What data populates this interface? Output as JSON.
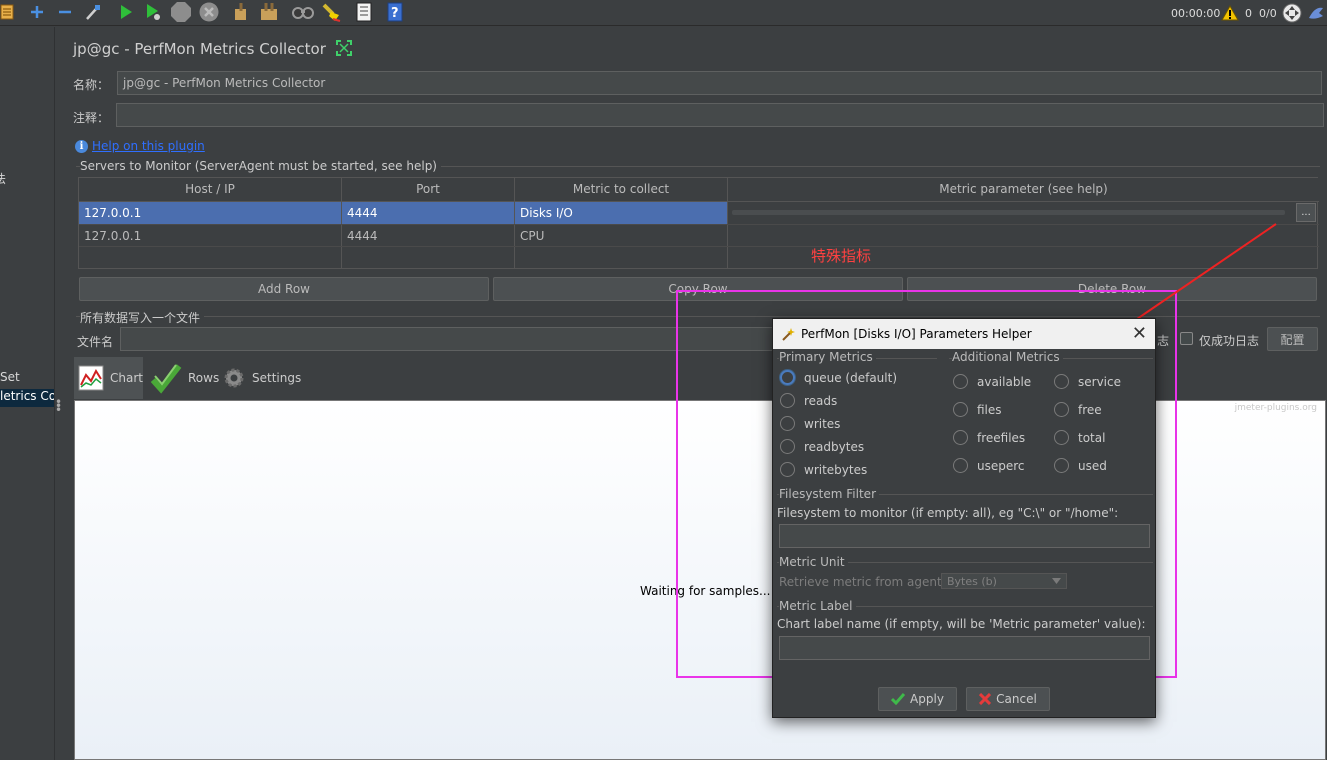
{
  "toolbar": {
    "timer": "00:00:00",
    "warnings": "0",
    "threads": "0/0",
    "icons": [
      "doc-icon",
      "plus-icon",
      "minus-icon",
      "toggle-icon",
      "start-icon",
      "start-no-pause-icon",
      "stop-icon",
      "shutdown-icon",
      "clear-icon",
      "clear-all-icon",
      "search-icon",
      "reset-search-icon",
      "function-helper-icon",
      "help-icon"
    ]
  },
  "tree": {
    "items": [
      {
        "label": "法"
      },
      {
        "label": "Set"
      },
      {
        "label": "letrics Coll"
      }
    ]
  },
  "panel": {
    "title": "jp@gc - PerfMon Metrics Collector",
    "name_label": "名称：",
    "name_value": "jp@gc - PerfMon Metrics Collector",
    "comment_label": "注释：",
    "comment_value": "",
    "help_link": "Help on this plugin",
    "servers_group": "Servers to Monitor (ServerAgent must be started, see help)",
    "table": {
      "headers": [
        "Host / IP",
        "Port",
        "Metric to collect",
        "Metric parameter (see help)"
      ],
      "rows": [
        {
          "host": "127.0.0.1",
          "port": "4444",
          "metric": "Disks I/O",
          "param": ""
        },
        {
          "host": "127.0.0.1",
          "port": "4444",
          "metric": "CPU",
          "param": ""
        }
      ],
      "param_button": "..."
    },
    "buttons": {
      "add_row": "Add Row",
      "copy_row": "Copy Row",
      "delete_row": "Delete Row"
    },
    "file_group": "所有数据写入一个文件",
    "filename_label": "文件名",
    "log_errors_suffix": "志",
    "success_only_label": "仅成功日志",
    "configure_button": "配置",
    "tabs": [
      {
        "label": "Chart"
      },
      {
        "label": "Rows"
      },
      {
        "label": "Settings"
      }
    ],
    "chart": {
      "watermark": "jmeter-plugins.org",
      "waiting": "Waiting for samples..."
    }
  },
  "annotation": {
    "note": "特殊指标",
    "color": "#ff4141",
    "box_color": "#e934e9"
  },
  "dialog": {
    "title": "PerfMon [Disks I/O] Parameters Helper",
    "primary_title": "Primary Metrics",
    "primary": [
      "queue (default)",
      "reads",
      "writes",
      "readbytes",
      "writebytes"
    ],
    "additional_title": "Additional Metrics",
    "additional": [
      [
        "available",
        "service"
      ],
      [
        "files",
        "free"
      ],
      [
        "freefiles",
        "total"
      ],
      [
        "useperc",
        "used"
      ]
    ],
    "fs_title": "Filesystem Filter",
    "fs_label": "Filesystem to monitor (if empty: all), eg \"C:\\\" or \"/home\":",
    "fs_value": "",
    "unit_title": "Metric Unit",
    "unit_label": "Retrieve metric from agent in:",
    "unit_value": "Bytes (b)",
    "label_title": "Metric Label",
    "label_label": "Chart label name (if empty, will be 'Metric parameter' value):",
    "label_value": "",
    "apply": "Apply",
    "cancel": "Cancel"
  }
}
